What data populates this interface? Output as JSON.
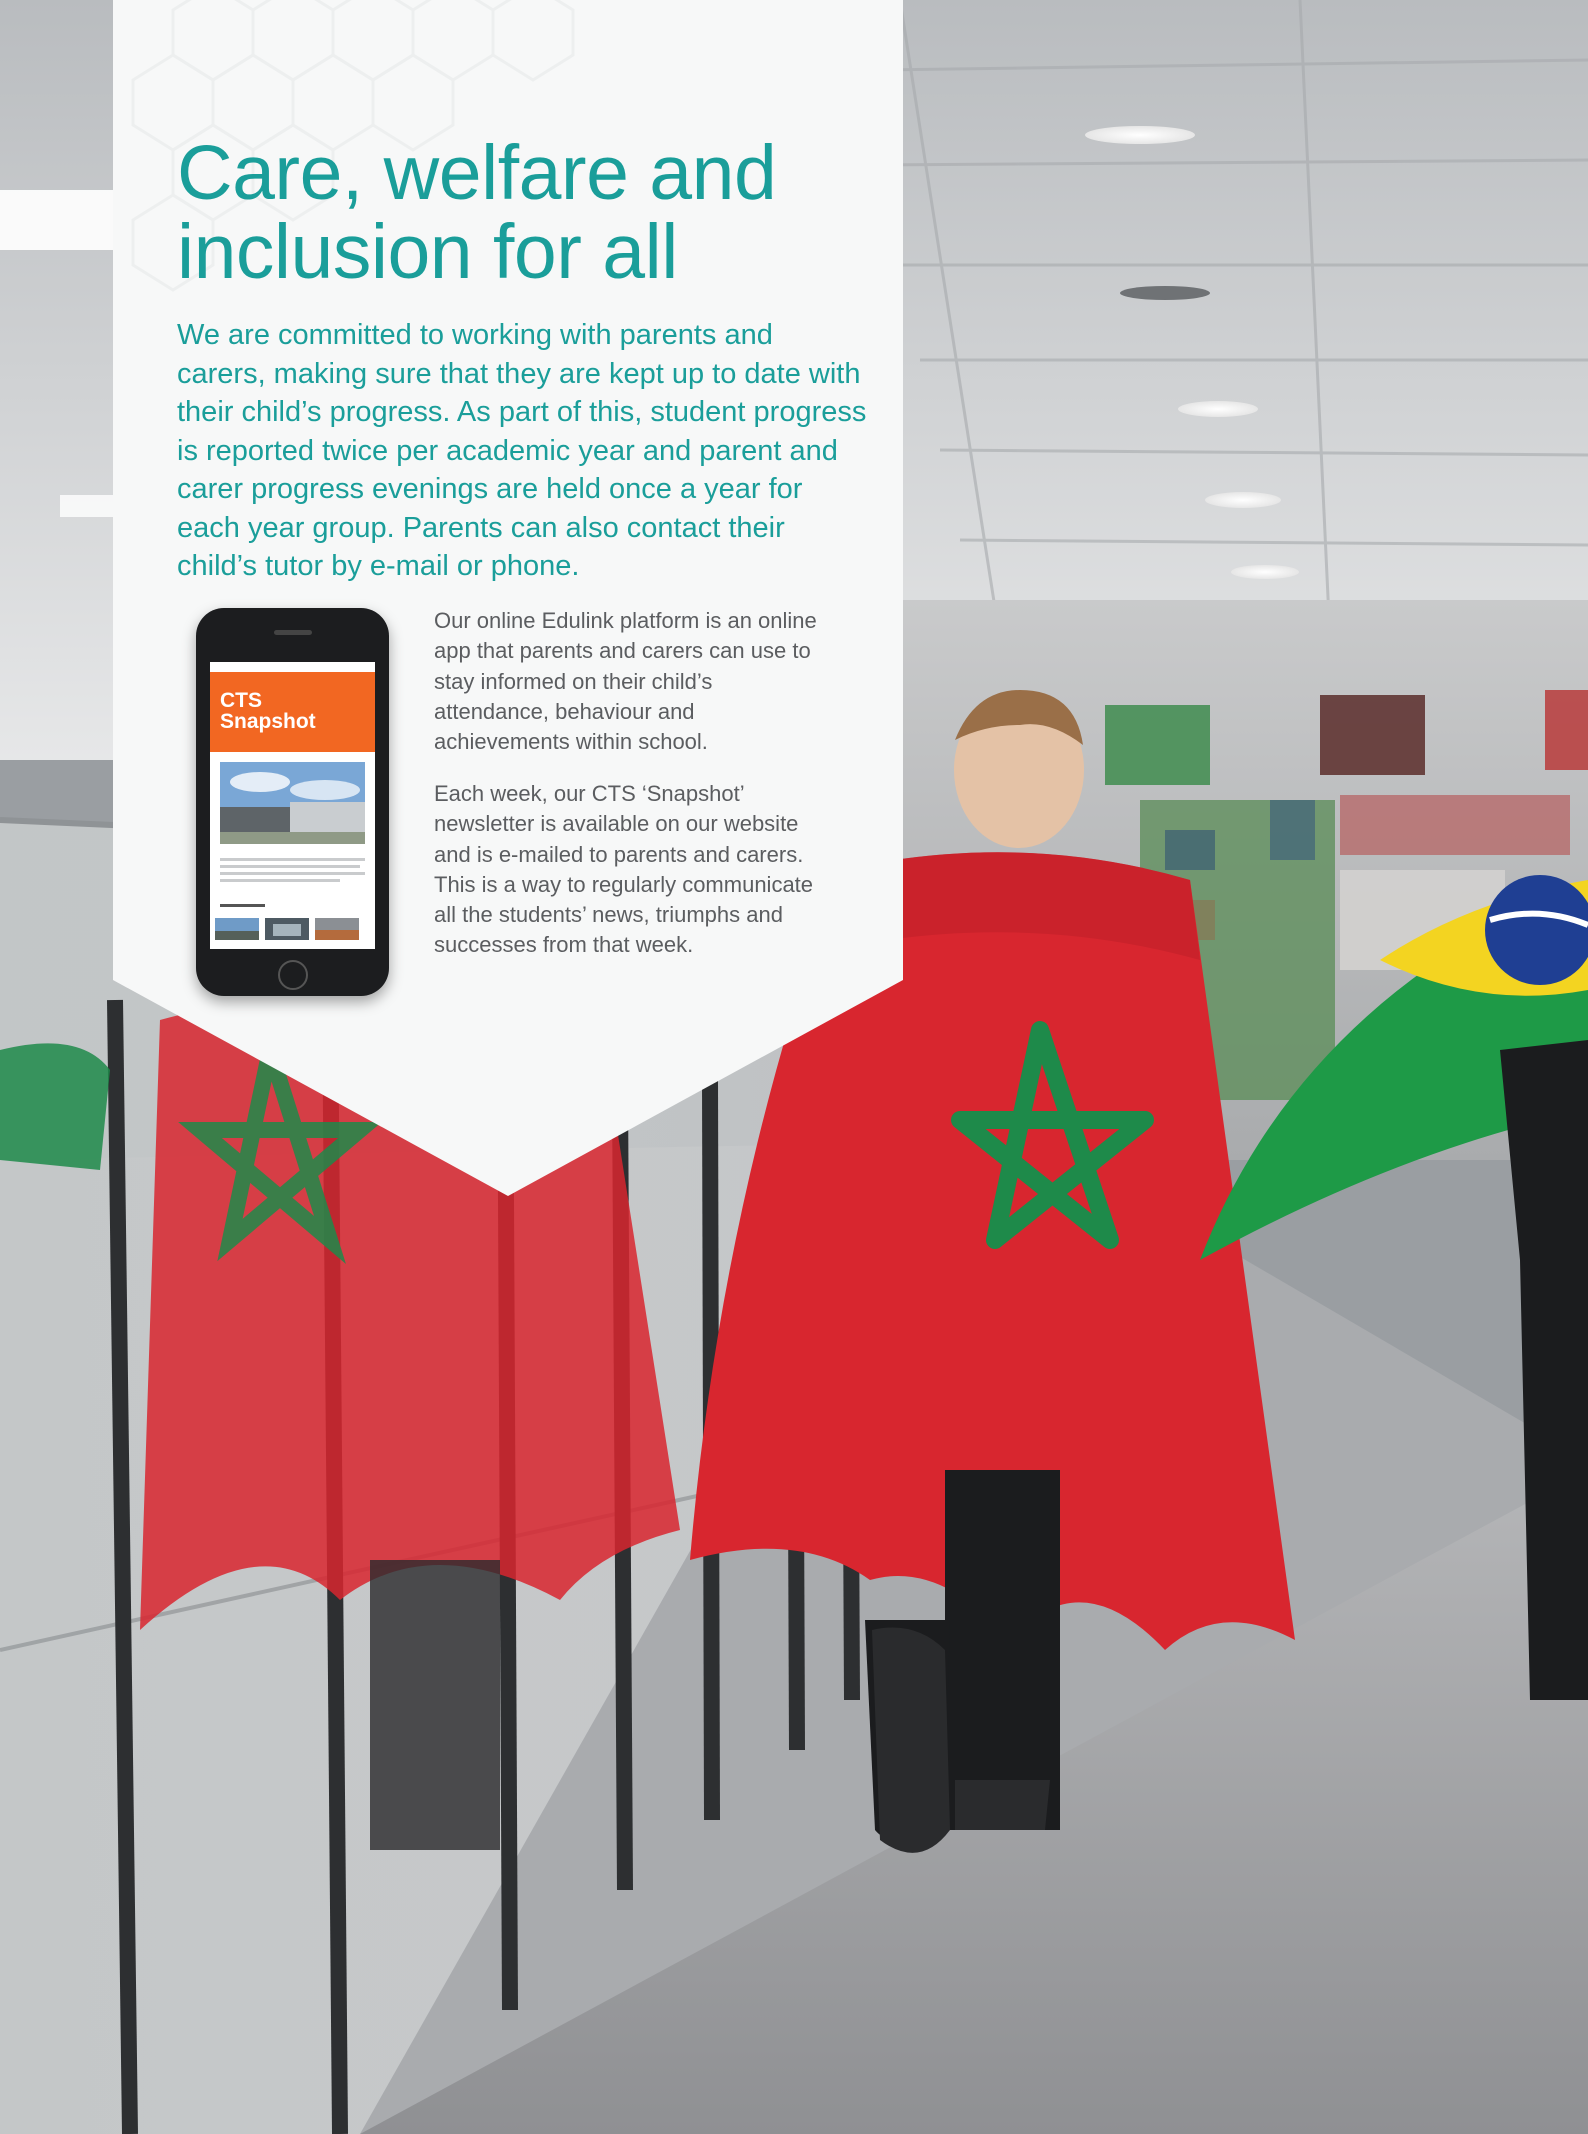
{
  "page": {
    "title": "Care, welfare and inclusion for all",
    "intro": "We are committed to working with parents and carers, making sure that they are kept up to date with their child’s progress. As part of this, student progress is reported twice per academic year and parent and carer progress evenings are held once a year for each year group. Parents can also contact their child’s tutor by e-mail or phone.",
    "edulink_text": "Our online Edulink platform is an online app that parents and carers can use to stay informed on their child’s attendance, behaviour and achievements within school.",
    "snapshot_text": "Each week, our CTS ‘Snapshot’ newsletter is available on our website and is e-mailed to parents and carers. This is a way to regularly communicate all the students’ news, triumphs and successes from that week."
  },
  "phone": {
    "app_title": "CTS\nSnapshot"
  },
  "colors": {
    "accent_teal": "#1a9e9a",
    "body_grey": "#5b5d60",
    "panel_white": "#f7f8f8",
    "flag_red": "#d8262f",
    "flag_green": "#1e8a4a",
    "app_orange": "#f26722"
  }
}
